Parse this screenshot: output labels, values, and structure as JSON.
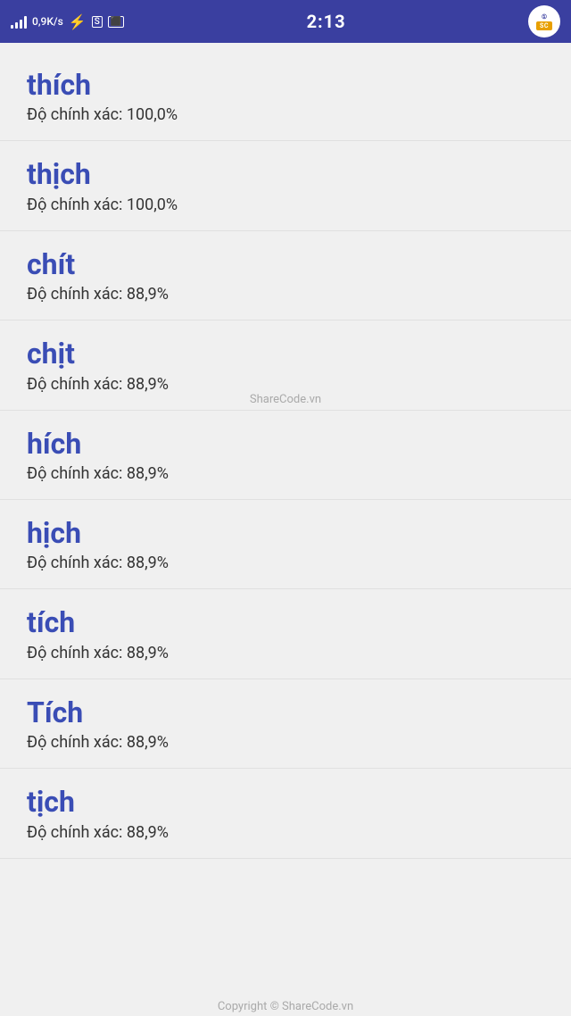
{
  "statusBar": {
    "signal": "signal",
    "speed": "0,9K/s",
    "time": "2:13",
    "logoText": "SHARE",
    "logoSubText": "CODE.vn"
  },
  "watermark1": "ShareCode.vn",
  "watermark2": "Copyright © ShareCode.vn",
  "words": [
    {
      "word": "thích",
      "accuracy": "Độ chính xác: 100,0%"
    },
    {
      "word": "thịch",
      "accuracy": "Độ chính xác: 100,0%"
    },
    {
      "word": "chít",
      "accuracy": "Độ chính xác: 88,9%"
    },
    {
      "word": "chịt",
      "accuracy": "Độ chính xác: 88,9%"
    },
    {
      "word": "hích",
      "accuracy": "Độ chính xác: 88,9%"
    },
    {
      "word": "hịch",
      "accuracy": "Độ chính xác: 88,9%"
    },
    {
      "word": "tích",
      "accuracy": "Độ chính xác: 88,9%"
    },
    {
      "word": "Tích",
      "accuracy": "Độ chính xác: 88,9%"
    },
    {
      "word": "tịch",
      "accuracy": "Độ chính xác: 88,9%"
    }
  ]
}
